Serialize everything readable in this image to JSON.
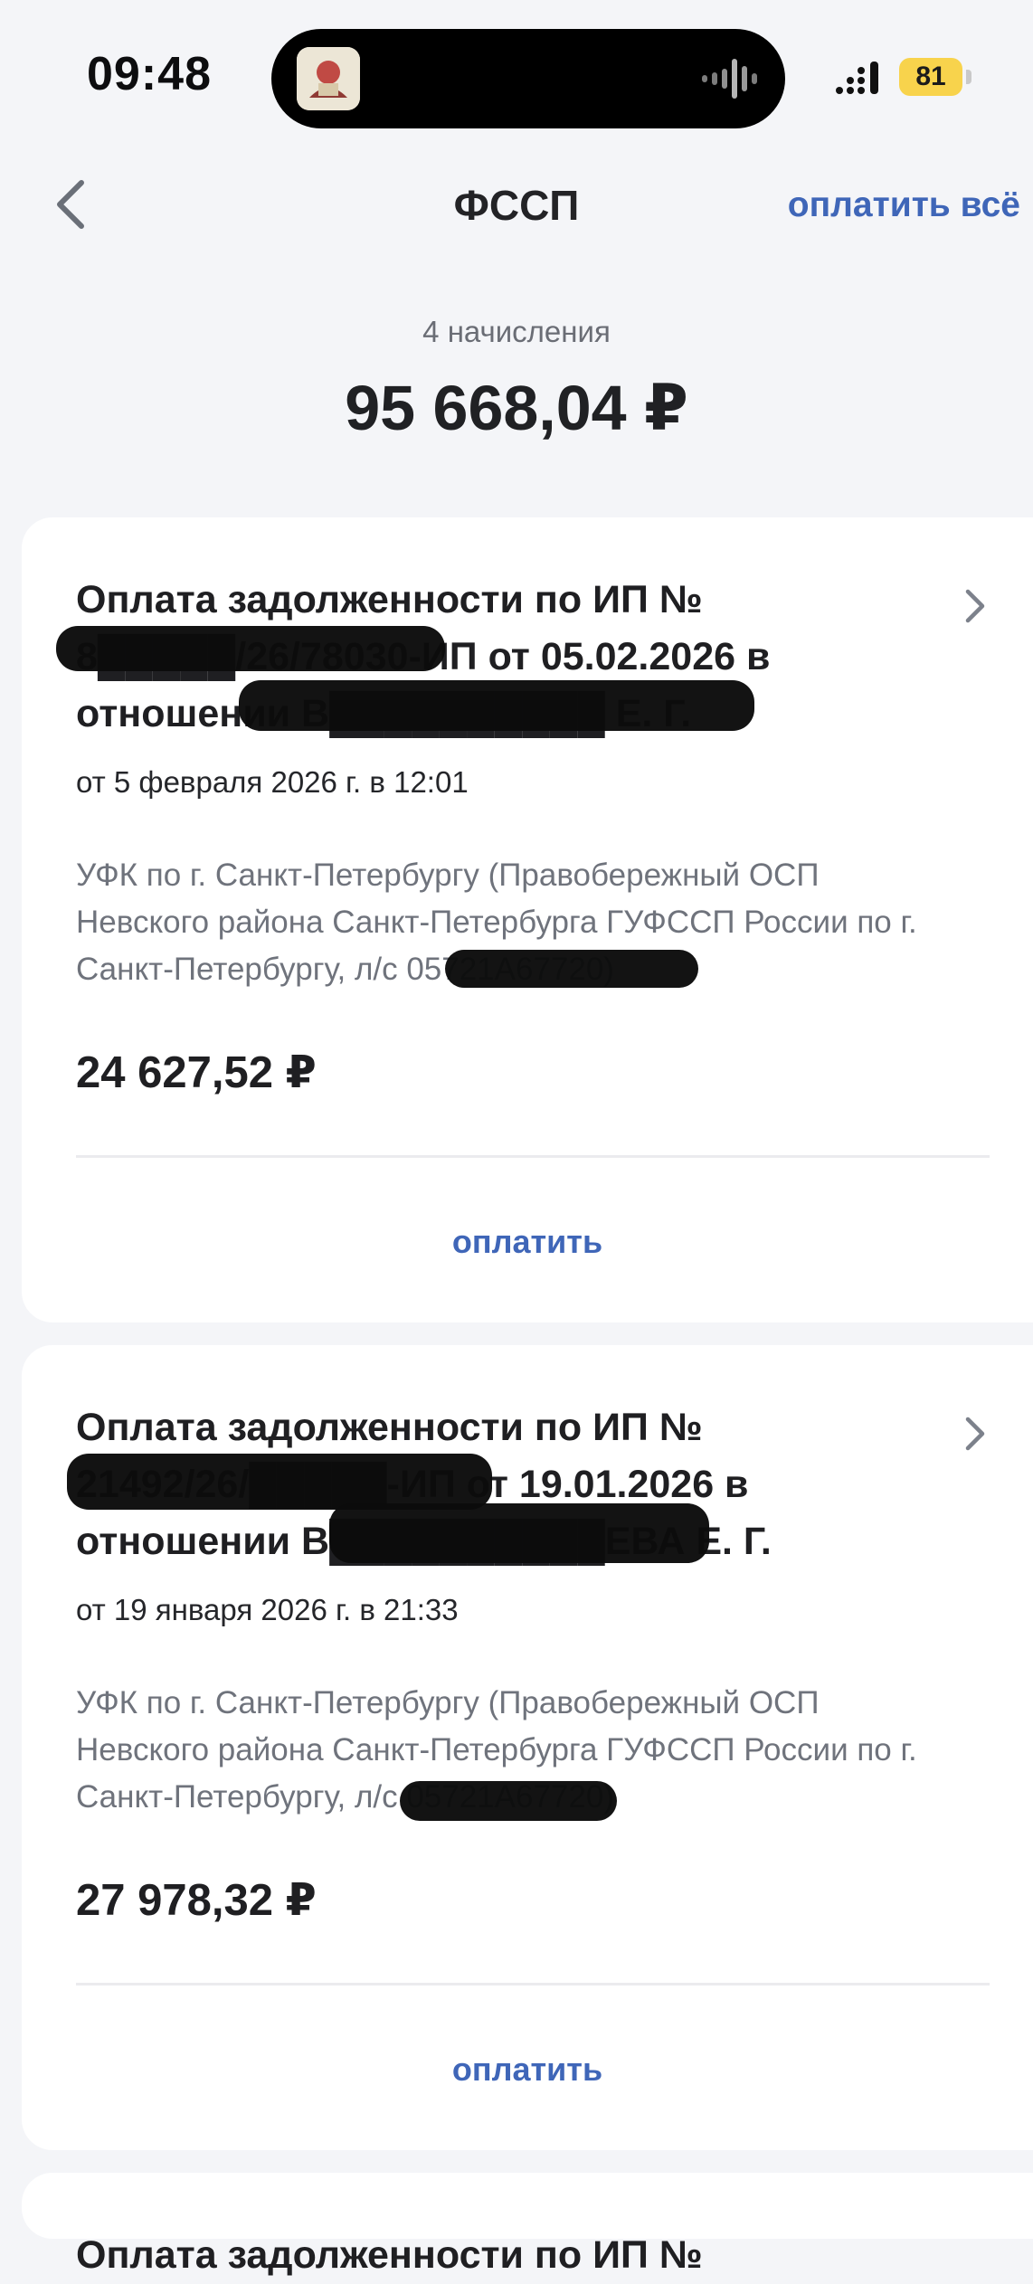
{
  "status_bar": {
    "time": "09:48",
    "battery": "81"
  },
  "nav": {
    "title": "ФССП",
    "pay_all": "оплатить всё"
  },
  "summary": {
    "count": "4 начисления",
    "total": "95 668,04 ₽"
  },
  "cards": [
    {
      "title_line1": "Оплата задолженности по ИП №",
      "title_line2": "8█████/26/78030-ИП от 05.02.2026 в",
      "title_line3": "отношении В██████████ Е. Г.",
      "date": "от 5 февраля 2026 г. в 12:01",
      "recipient_line1": "УФК по г. Санкт-Петербургу (Правобережный ОСП",
      "recipient_line2": "Невского района Санкт-Петербурга ГУФССП России по г.",
      "recipient_line3": "Санкт-Петербургу, л/с 05721А67720)",
      "amount": "24 627,52 ₽",
      "pay_label": "оплатить"
    },
    {
      "title_line1": "Оплата задолженности по ИП №",
      "title_line2": "21492/26/█████-ИП от 19.01.2026 в",
      "title_line3": "отношении В██████████ЕВА Е. Г.",
      "date": "от 19 января 2026 г. в 21:33",
      "recipient_line1": "УФК по г. Санкт-Петербургу (Правобережный ОСП",
      "recipient_line2": "Невского района Санкт-Петербурга ГУФССП России по г.",
      "recipient_line3": "Санкт-Петербургу, л/с 05721А67720)",
      "amount": "27 978,32 ₽",
      "pay_label": "оплатить"
    },
    {
      "title_line1": "Оплата задолженности по ИП №"
    }
  ],
  "icons": {
    "back": "chevron-left-icon",
    "open_card": "chevron-right-icon"
  },
  "colors": {
    "accent": "#3f66b8",
    "background": "#f4f5f8",
    "card": "#ffffff"
  }
}
